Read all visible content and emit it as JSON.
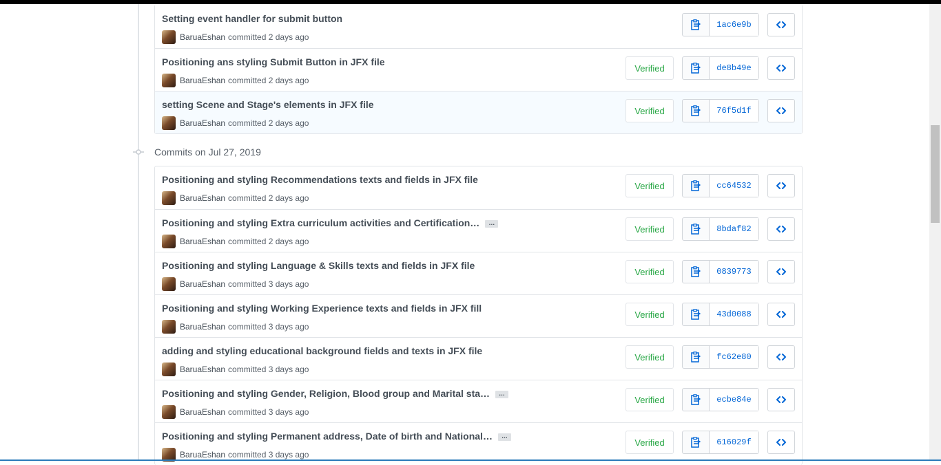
{
  "group1": [
    {
      "title": "Setting event handler for submit button",
      "has_ellipsis": false,
      "author": "BaruaEshan",
      "time": "committed 2 days ago",
      "verified": "",
      "sha": "1ac6e9b"
    },
    {
      "title": "Positioning ans styling Submit Button in JFX file",
      "has_ellipsis": false,
      "author": "BaruaEshan",
      "time": "committed 2 days ago",
      "verified": "Verified",
      "sha": "de8b49e"
    },
    {
      "title": "setting Scene and Stage's elements in JFX file",
      "has_ellipsis": false,
      "author": "BaruaEshan",
      "time": "committed 2 days ago",
      "verified": "Verified",
      "sha": "76f5d1f",
      "highlighted": true
    }
  ],
  "date_header": "Commits on Jul 27, 2019",
  "group2": [
    {
      "title": "Positioning and styling Recommendations texts and fields in JFX file",
      "has_ellipsis": false,
      "author": "BaruaEshan",
      "time": "committed 2 days ago",
      "verified": "Verified",
      "sha": "cc64532"
    },
    {
      "title": "Positioning and styling Extra curriculum activities and Certification…",
      "has_ellipsis": true,
      "author": "BaruaEshan",
      "time": "committed 2 days ago",
      "verified": "Verified",
      "sha": "8bdaf82"
    },
    {
      "title": "Positioning and styling Language & Skills texts and fields in JFX file",
      "has_ellipsis": false,
      "author": "BaruaEshan",
      "time": "committed 3 days ago",
      "verified": "Verified",
      "sha": "0839773"
    },
    {
      "title": "Positioning and styling Working Experience texts and fields in JFX fill",
      "has_ellipsis": false,
      "author": "BaruaEshan",
      "time": "committed 3 days ago",
      "verified": "Verified",
      "sha": "43d0088"
    },
    {
      "title": "adding and styling educational background fields and texts in JFX file",
      "has_ellipsis": false,
      "author": "BaruaEshan",
      "time": "committed 3 days ago",
      "verified": "Verified",
      "sha": "fc62e80"
    },
    {
      "title": "Positioning and styling Gender, Religion, Blood group and Marital sta…",
      "has_ellipsis": true,
      "author": "BaruaEshan",
      "time": "committed 3 days ago",
      "verified": "Verified",
      "sha": "ecbe84e"
    },
    {
      "title": "Positioning and styling Permanent address, Date of birth and National…",
      "has_ellipsis": true,
      "author": "BaruaEshan",
      "time": "committed 3 days ago",
      "verified": "Verified",
      "sha": "616029f"
    }
  ],
  "ellipsis_label": "…",
  "icons": {
    "copy": "clipboard-icon",
    "browse": "code-icon",
    "commit": "git-commit-icon"
  },
  "colors": {
    "verified": "#28a745",
    "sha": "#0366d6",
    "highlight_row": "#f6fbff"
  }
}
